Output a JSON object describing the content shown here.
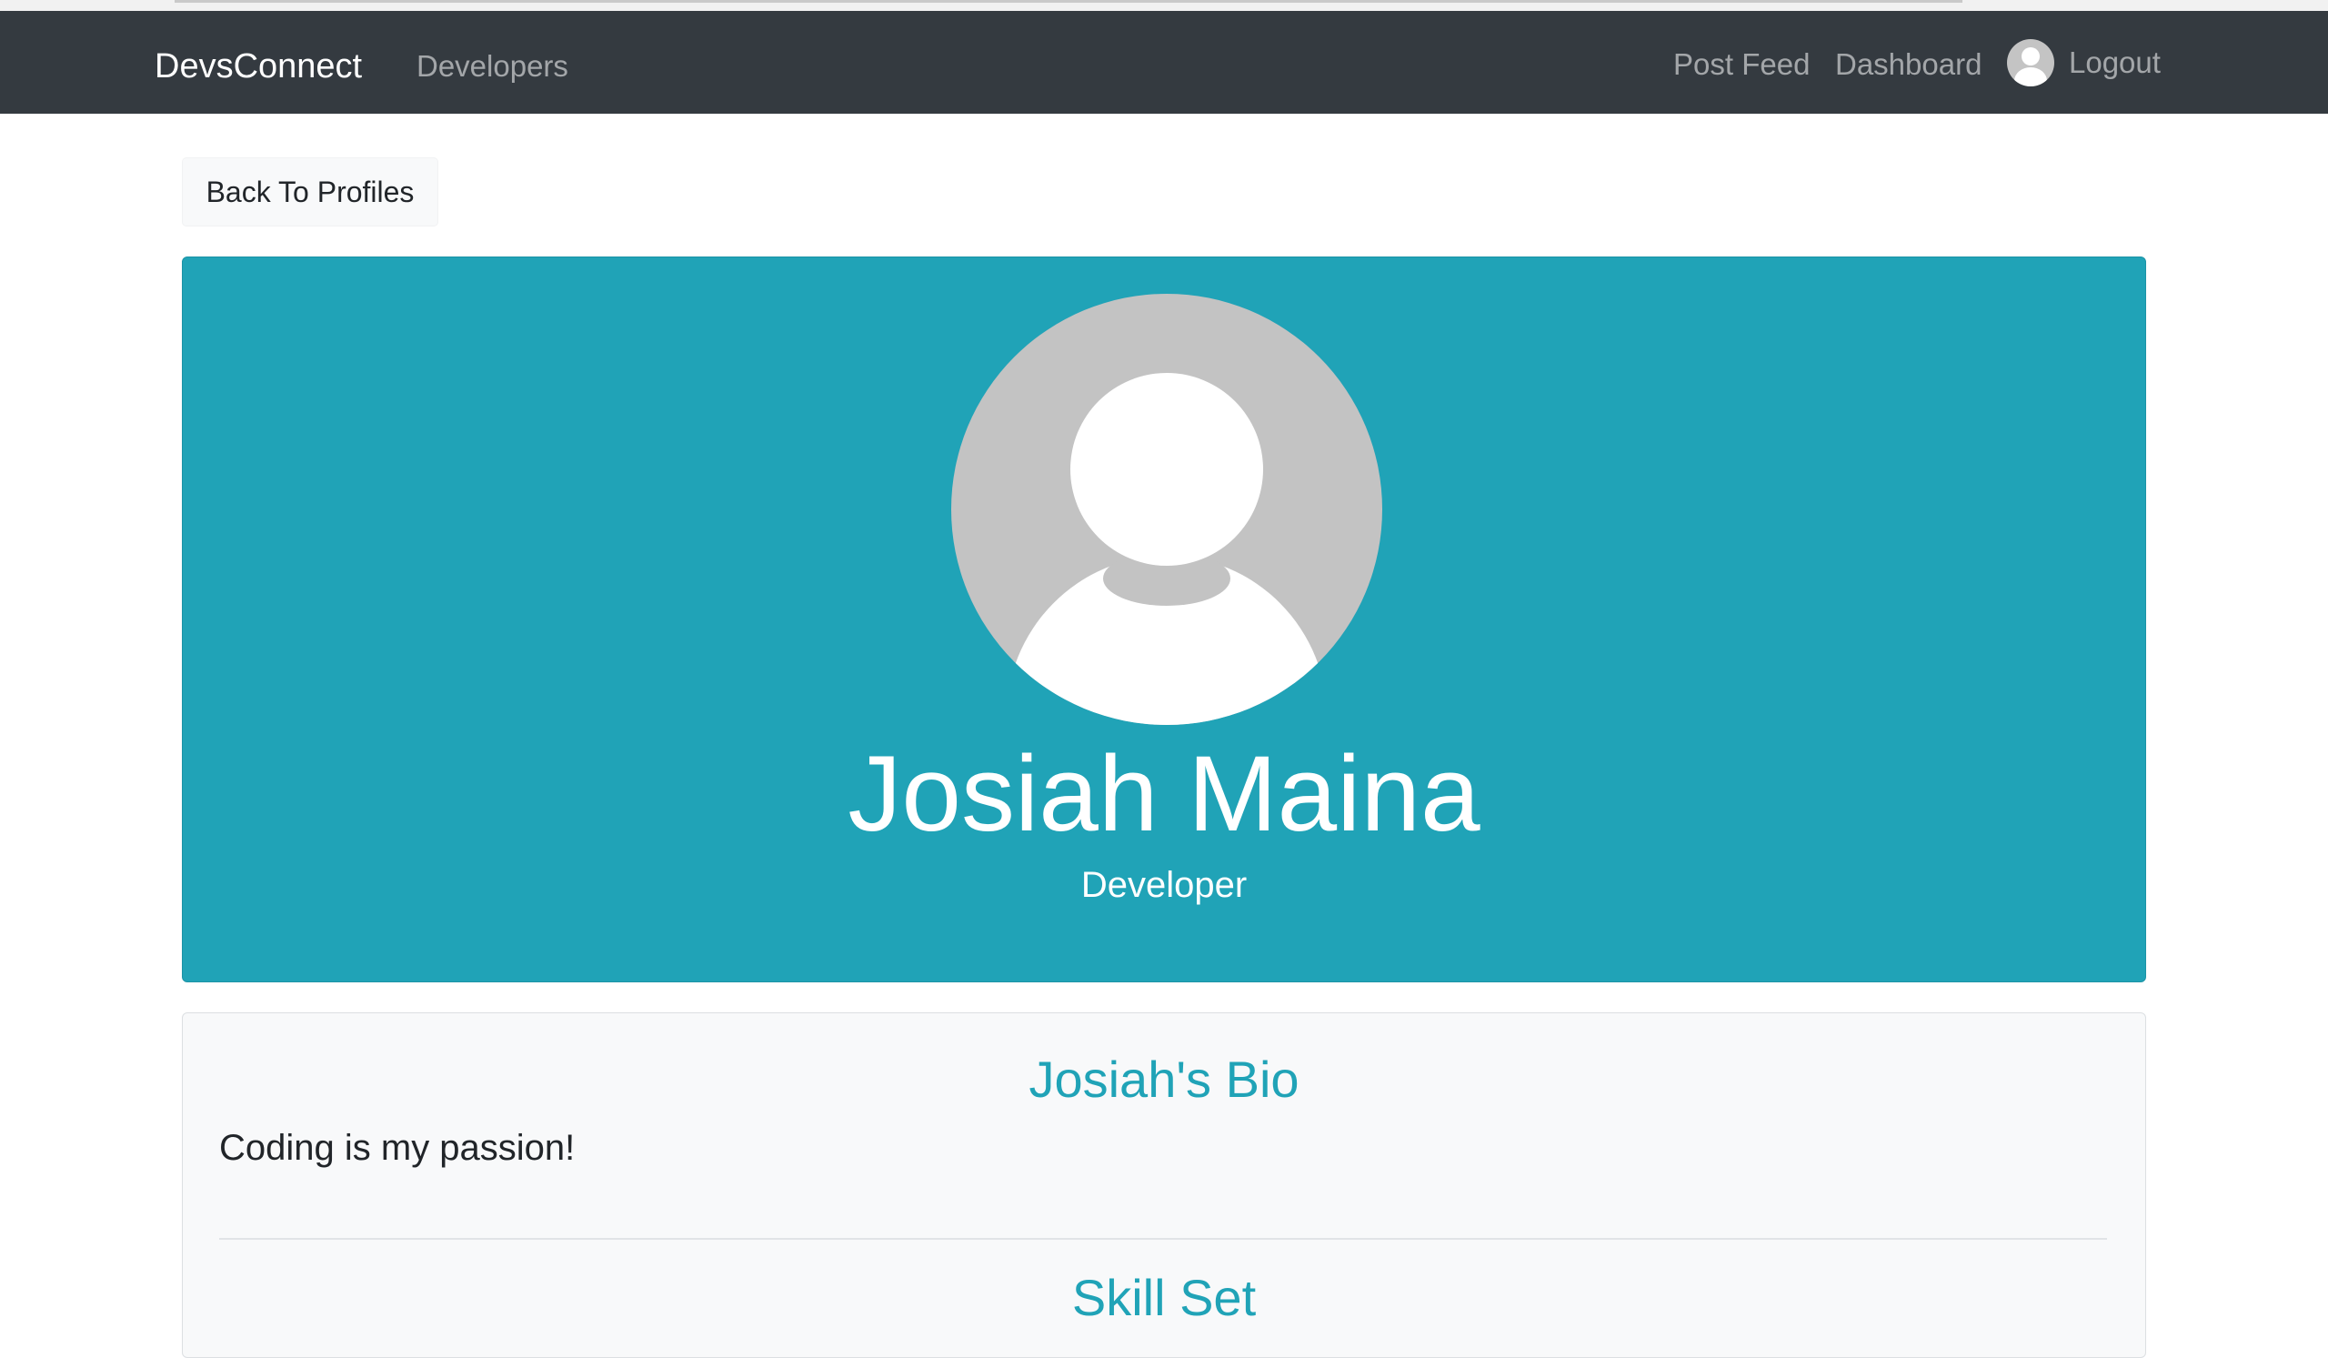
{
  "navbar": {
    "brand": "DevsConnect",
    "developers_label": "Developers",
    "post_feed_label": "Post Feed",
    "dashboard_label": "Dashboard",
    "logout_label": "Logout"
  },
  "back_button": {
    "label": "Back To Profiles"
  },
  "profile": {
    "name": "Josiah Maina",
    "status": "Developer",
    "bio_title": "Josiah's Bio",
    "bio_text": "Coding is my passion!",
    "skills_title": "Skill Set"
  },
  "colors": {
    "navbar_bg": "#343a40",
    "accent": "#20a3b7",
    "card_bg": "#f8f9fa"
  },
  "icons": {
    "nav_avatar": "user-avatar-icon",
    "profile_avatar": "default-user-avatar"
  }
}
